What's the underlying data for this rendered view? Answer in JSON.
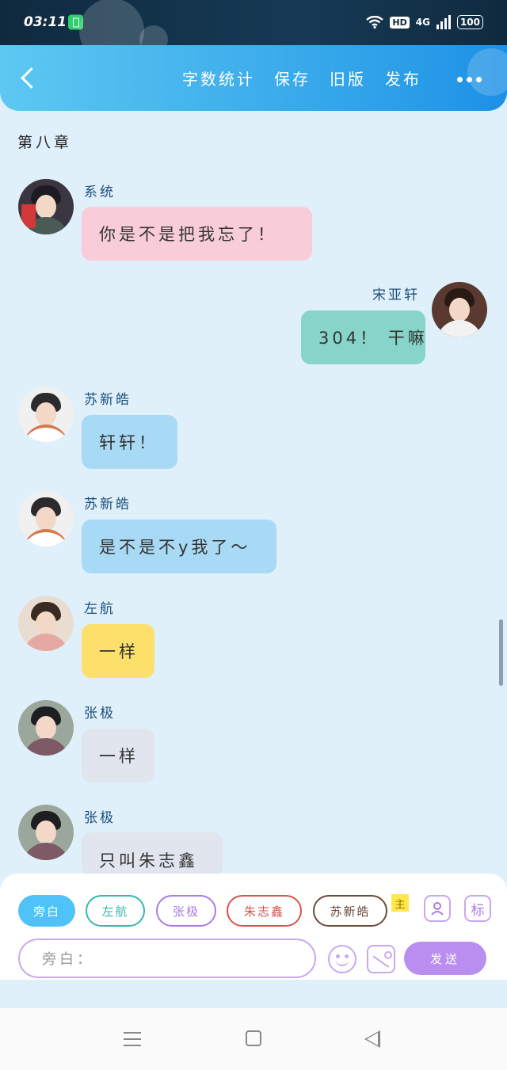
{
  "status_bar": {
    "time": "03:11",
    "hd": "HD",
    "network": "4G",
    "battery": "100"
  },
  "toolbar": {
    "items": [
      "字数统计",
      "保存",
      "旧版",
      "发布"
    ]
  },
  "chapter_title": "第八章",
  "messages": [
    {
      "sender": "系统",
      "text": "你是不是把我忘了！",
      "side": "left",
      "color": "#f8cdd9"
    },
    {
      "sender": "宋亚轩",
      "text": "304！ 干嘛",
      "side": "right",
      "color": "#86d5c8"
    },
    {
      "sender": "苏新皓",
      "text": "轩轩！",
      "side": "left",
      "color": "#a8daf5"
    },
    {
      "sender": "苏新皓",
      "text": "是不是不y我了～",
      "side": "left",
      "color": "#a8daf5"
    },
    {
      "sender": "左航",
      "text": "一样",
      "side": "left",
      "color": "#fddf6c"
    },
    {
      "sender": "张极",
      "text": "一样",
      "side": "left",
      "color": "#e1e5ee"
    },
    {
      "sender": "张极",
      "text": "只叫朱志鑫",
      "side": "left",
      "color": "#e1e5ee"
    }
  ],
  "role_chips": [
    {
      "label": "旁白",
      "color": "#4fc3f7",
      "active": true
    },
    {
      "label": "左航",
      "color": "#36b8ad",
      "active": false
    },
    {
      "label": "张极",
      "color": "#a97be8",
      "active": false
    },
    {
      "label": "朱志鑫",
      "color": "#d9534f",
      "active": false
    },
    {
      "label": "苏新皓",
      "color": "#6b4a3a",
      "active": false
    }
  ],
  "main_tag": "主",
  "mark_button": "标",
  "input": {
    "placeholder": "旁白："
  },
  "send_label": "发送",
  "icons": [
    "back-icon",
    "more-icon",
    "add-role-icon",
    "emoji-icon",
    "image-icon",
    "menu-icon",
    "home-icon",
    "nav-back-icon"
  ]
}
